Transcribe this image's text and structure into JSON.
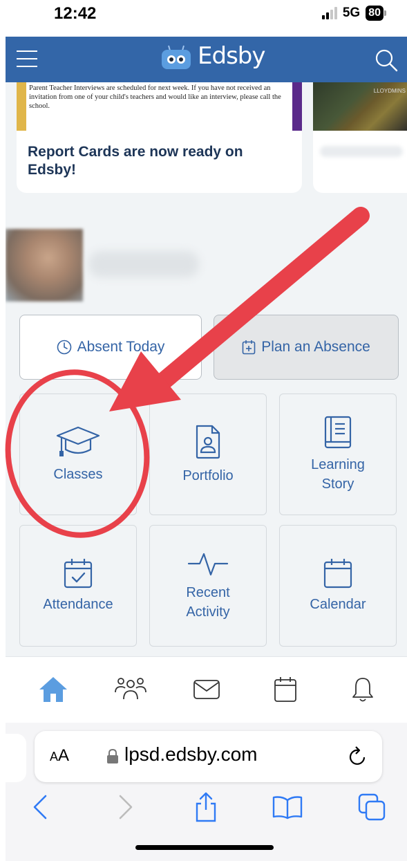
{
  "status_bar": {
    "time": "12:42",
    "network": "5G",
    "battery": "80"
  },
  "header": {
    "app_name": "Edsby",
    "menu_icon": "hamburger-menu-icon",
    "search_icon": "search-icon"
  },
  "news": [
    {
      "snippet": "Parent Teacher Interviews are scheduled for next week.  If you have not received an invitation from one of your child's teachers and would like an interview, please call the school.",
      "title": "Report Cards are now ready on Edsby!"
    },
    {
      "photo_sign": "LLOYDMINS"
    }
  ],
  "actions": {
    "absent_today": {
      "label": "Absent Today",
      "icon": "clock-icon"
    },
    "plan_absence": {
      "label": "Plan an Absence",
      "icon": "calendar-plus-icon"
    }
  },
  "tiles": [
    {
      "label": "Classes",
      "icon": "graduation-cap-icon"
    },
    {
      "label": "Portfolio",
      "icon": "portfolio-icon"
    },
    {
      "label_line1": "Learning",
      "label_line2": "Story",
      "icon": "book-icon"
    },
    {
      "label": "Attendance",
      "icon": "calendar-check-icon"
    },
    {
      "label_line1": "Recent",
      "label_line2": "Activity",
      "icon": "activity-pulse-icon"
    },
    {
      "label": "Calendar",
      "icon": "calendar-icon"
    }
  ],
  "bottom_nav": [
    "home-icon",
    "people-icon",
    "mail-icon",
    "calendar-icon",
    "bell-icon"
  ],
  "browser": {
    "aa_label_small": "A",
    "aa_label_large": "A",
    "url": "lpsd.edsby.com"
  },
  "colors": {
    "header": "#3366a8",
    "accent": "#3464a6",
    "annotation": "#e8414a"
  }
}
